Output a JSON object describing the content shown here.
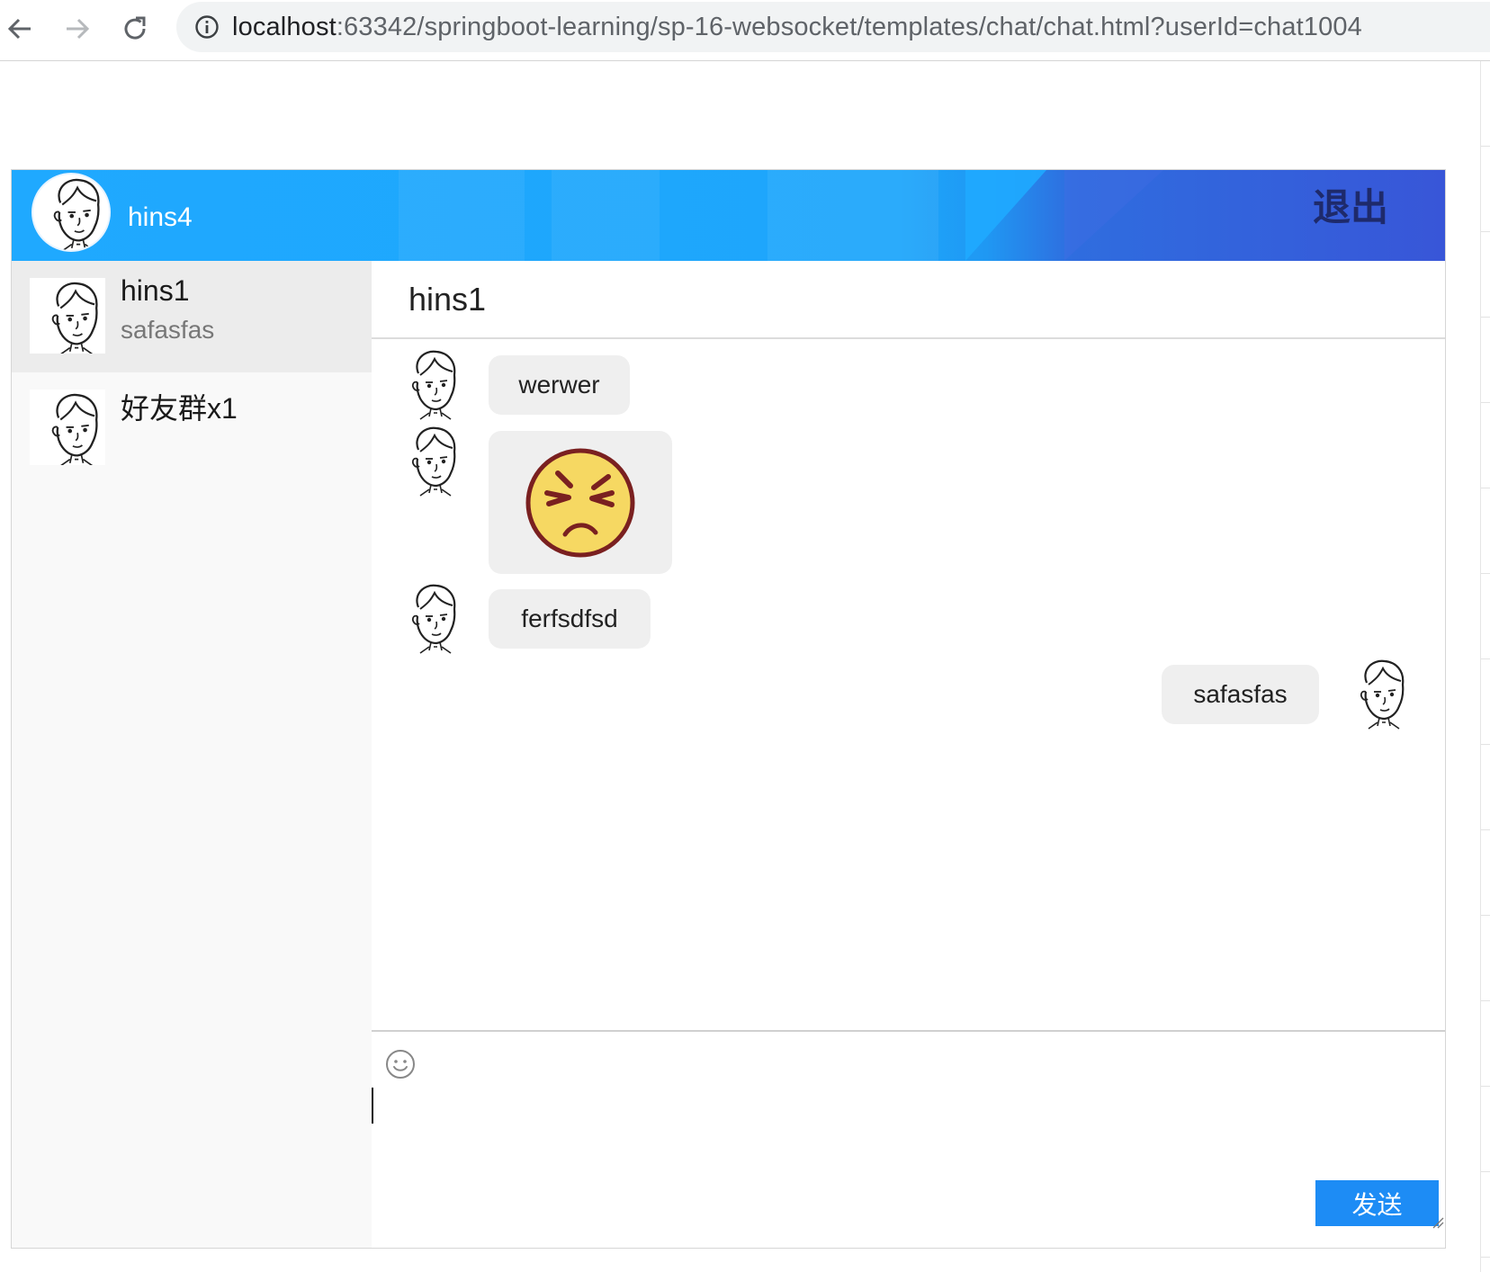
{
  "browser": {
    "url_host": "localhost",
    "url_rest": ":63342/springboot-learning/sp-16-websocket/templates/chat/chat.html?userId=chat1004"
  },
  "header": {
    "username": "hins4",
    "logout_label": "退出"
  },
  "contacts": [
    {
      "name": "hins1",
      "preview": "safasfas",
      "active": true
    },
    {
      "name": "好友群x1",
      "preview": "",
      "active": false
    }
  ],
  "chat": {
    "title": "hins1",
    "messages": [
      {
        "side": "left",
        "type": "text",
        "text": "werwer"
      },
      {
        "side": "left",
        "type": "emoji",
        "emoji": "squinting-angry-face"
      },
      {
        "side": "left",
        "type": "text",
        "text": "ferfsdfsd"
      },
      {
        "side": "right",
        "type": "text",
        "text": "safasfas"
      }
    ]
  },
  "composer": {
    "input_value": "",
    "send_label": "发送",
    "emoji_icon": "smiley-icon"
  },
  "colors": {
    "header_blue": "#1fa9ff",
    "header_dark_blue": "#3856d8",
    "send_blue": "#1d8cf5",
    "bubble_gray": "#efefef",
    "sidebar_bg": "#f9f9f9",
    "active_contact_bg": "#ececec"
  }
}
